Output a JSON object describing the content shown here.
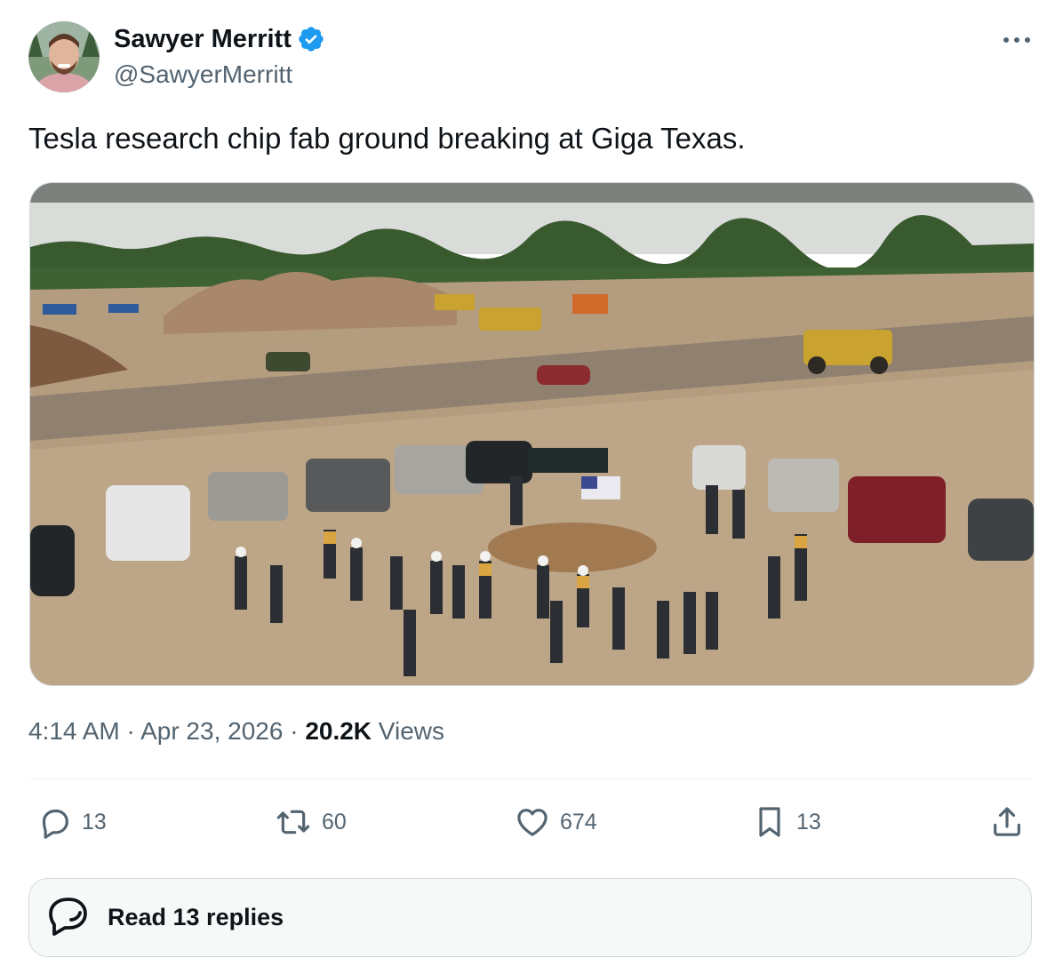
{
  "author": {
    "name": "Sawyer Merritt",
    "handle": "@SawyerMerritt",
    "verified_icon": "verified-badge-icon",
    "avatar": "avatar"
  },
  "tweet": {
    "text": "Tesla research chip fab ground breaking at Giga Texas."
  },
  "meta": {
    "time": "4:14 AM",
    "sep1": " · ",
    "date": "Apr 23, 2026",
    "sep2": " · ",
    "views_count": "20.2K",
    "views_label": " Views"
  },
  "actions": {
    "replies": "13",
    "reposts": "60",
    "likes": "674",
    "bookmarks": "13"
  },
  "read_replies": {
    "label": "Read 13 replies"
  },
  "colors": {
    "accent": "#1d9bf0",
    "text_primary": "#0f1419",
    "text_secondary": "#536471",
    "border": "#cfd9de"
  }
}
